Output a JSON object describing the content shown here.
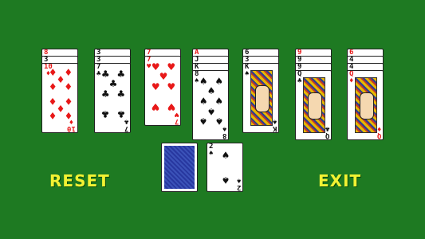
{
  "colors": {
    "felt": "#1e7a22",
    "button_text": "#f2f233",
    "red_suit": "#e81818"
  },
  "buttons": {
    "reset_label": "RESET",
    "exit_label": "EXIT"
  },
  "tableau": [
    {
      "cards": [
        {
          "rank": "8",
          "suit": "♦",
          "color": "red"
        },
        {
          "rank": "3",
          "suit": "♣",
          "color": "black"
        },
        {
          "rank": "10",
          "suit": "♦",
          "color": "red"
        }
      ]
    },
    {
      "cards": [
        {
          "rank": "3",
          "suit": "♠",
          "color": "black"
        },
        {
          "rank": "3",
          "suit": "♠",
          "color": "black"
        },
        {
          "rank": "7",
          "suit": "♣",
          "color": "black"
        }
      ]
    },
    {
      "cards": [
        {
          "rank": "7",
          "suit": "♦",
          "color": "red"
        },
        {
          "rank": "7",
          "suit": "♥",
          "color": "red"
        }
      ]
    },
    {
      "cards": [
        {
          "rank": "A",
          "suit": "♦",
          "color": "red"
        },
        {
          "rank": "J",
          "suit": "♣",
          "color": "black"
        },
        {
          "rank": "K",
          "suit": "♠",
          "color": "black"
        },
        {
          "rank": "8",
          "suit": "♠",
          "color": "black"
        }
      ]
    },
    {
      "cards": [
        {
          "rank": "6",
          "suit": "♠",
          "color": "black"
        },
        {
          "rank": "3",
          "suit": "♠",
          "color": "black"
        },
        {
          "rank": "K",
          "suit": "♠",
          "color": "black"
        }
      ]
    },
    {
      "cards": [
        {
          "rank": "9",
          "suit": "♦",
          "color": "red"
        },
        {
          "rank": "9",
          "suit": "♣",
          "color": "black"
        },
        {
          "rank": "9",
          "suit": "♣",
          "color": "black"
        },
        {
          "rank": "Q",
          "suit": "♣",
          "color": "black"
        }
      ]
    },
    {
      "cards": [
        {
          "rank": "6",
          "suit": "♦",
          "color": "red"
        },
        {
          "rank": "4",
          "suit": "♠",
          "color": "black"
        },
        {
          "rank": "4",
          "suit": "♣",
          "color": "black"
        },
        {
          "rank": "Q",
          "suit": "♦",
          "color": "red"
        }
      ]
    }
  ],
  "stock": {
    "icon": "card-back"
  },
  "waste": {
    "rank": "2",
    "suit": "♠",
    "color": "black"
  }
}
